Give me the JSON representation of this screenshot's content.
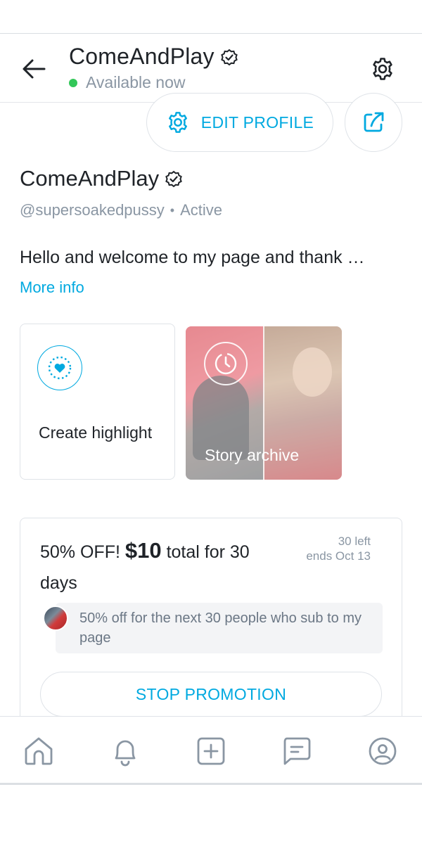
{
  "header": {
    "title": "ComeAndPlay",
    "status": "Available now",
    "status_color": "#33c759"
  },
  "actions": {
    "edit_profile_label": "EDIT PROFILE",
    "accent_color": "#00a9e0"
  },
  "profile": {
    "name": "ComeAndPlay",
    "handle": "@supersoakedpussy",
    "separator": "•",
    "activity": "Active",
    "bio": "Hello and welcome to my page and thank …",
    "more_info": "More info"
  },
  "highlights": {
    "create_label": "Create highlight",
    "archive_label": "Story archive"
  },
  "promotion": {
    "title_prefix": "50% OFF!",
    "title_price": "$10",
    "title_suffix": "total for 30 days",
    "remaining": "30 left",
    "ends": "ends Oct 13",
    "note": "50% off for the next 30 people who sub to my page",
    "stop_label": "STOP PROMOTION"
  },
  "nav": {
    "items": [
      {
        "icon": "home-icon"
      },
      {
        "icon": "bell-icon"
      },
      {
        "icon": "add-post-icon"
      },
      {
        "icon": "messages-icon"
      },
      {
        "icon": "profile-icon"
      }
    ]
  }
}
